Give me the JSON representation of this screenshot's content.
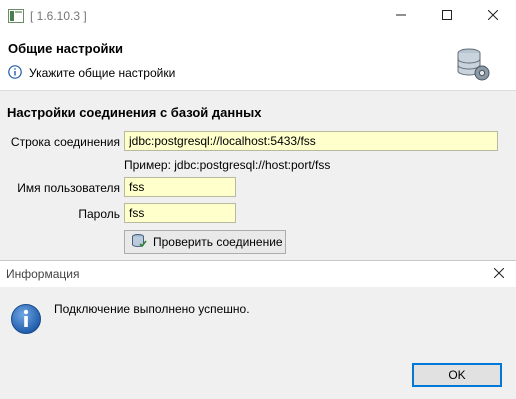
{
  "window": {
    "title": "[ 1.6.10.3 ]",
    "controls": {
      "minimize": "minimize",
      "maximize": "maximize",
      "close": "close"
    }
  },
  "header": {
    "title": "Общие настройки",
    "description": "Укажите общие настройки"
  },
  "db_settings": {
    "group_title": "Настройки соединения с базой данных",
    "connection_label": "Строка соединения",
    "connection_value": "jdbc:postgresql://localhost:5433/fss",
    "example_text": "Пример: jdbc:postgresql://host:port/fss",
    "username_label": "Имя пользователя",
    "username_value": "fss",
    "password_label": "Пароль",
    "password_value": "fss",
    "test_button_label": "Проверить соединение"
  },
  "dialog": {
    "title": "Информация",
    "message": "Подключение выполнено успешно.",
    "ok_label": "OK"
  },
  "colors": {
    "field_bg": "#ffffcc",
    "panel_bg": "#f0f0f0",
    "accent": "#0078d7",
    "info_icon": "#1e5aa8"
  },
  "icons": [
    "app-icon",
    "info-icon",
    "database-settings-icon",
    "database-test-icon",
    "info-large-icon",
    "close-icon",
    "minimize-icon",
    "maximize-icon"
  ]
}
